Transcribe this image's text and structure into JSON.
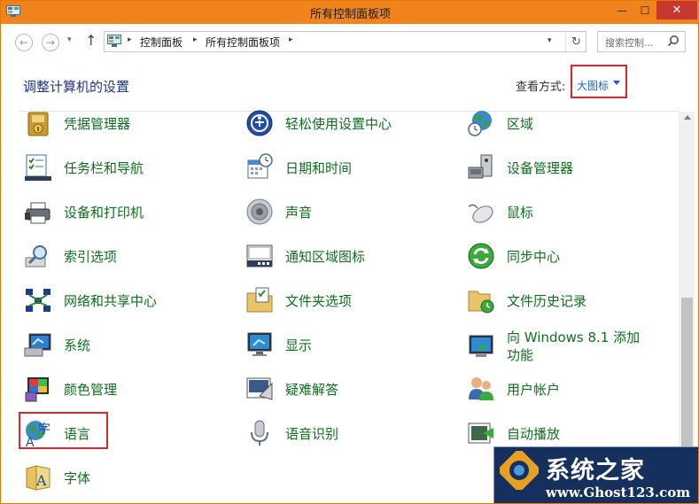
{
  "window": {
    "title": "所有控制面板项",
    "minimize_label": "—",
    "maximize_label": "☐",
    "close_label": "✕",
    "icon": "control-panel-icon"
  },
  "nav": {
    "back_label": "←",
    "forward_label": "→",
    "history_label": "▾",
    "up_label": "↑",
    "breadcrumbs": [
      "控制面板",
      "所有控制面板项"
    ],
    "separator": "▸",
    "dropdown_label": "▾",
    "refresh_label": "↻",
    "search_placeholder": "搜索控制..."
  },
  "header": {
    "title": "调整计算机的设置",
    "view_by_label": "查看方式:",
    "view_by_value": "大图标"
  },
  "items": [
    [
      {
        "label": "凭据管理器",
        "icon": "credential-manager-icon"
      },
      {
        "label": "任务栏和导航",
        "icon": "taskbar-icon"
      },
      {
        "label": "设备和打印机",
        "icon": "printer-icon"
      },
      {
        "label": "索引选项",
        "icon": "indexing-icon"
      },
      {
        "label": "网络和共享中心",
        "icon": "network-icon"
      },
      {
        "label": "系统",
        "icon": "system-icon"
      },
      {
        "label": "颜色管理",
        "icon": "color-management-icon"
      },
      {
        "label": "语言",
        "icon": "language-icon"
      },
      {
        "label": "字体",
        "icon": "fonts-icon"
      }
    ],
    [
      {
        "label": "轻松使用设置中心",
        "icon": "ease-of-access-icon"
      },
      {
        "label": "日期和时间",
        "icon": "calendar-clock-icon"
      },
      {
        "label": "声音",
        "icon": "speaker-icon"
      },
      {
        "label": "通知区域图标",
        "icon": "notification-area-icon"
      },
      {
        "label": "文件夹选项",
        "icon": "folder-options-icon"
      },
      {
        "label": "显示",
        "icon": "display-icon"
      },
      {
        "label": "疑难解答",
        "icon": "troubleshooting-icon"
      },
      {
        "label": "语音识别",
        "icon": "microphone-icon"
      }
    ],
    [
      {
        "label": "区域",
        "icon": "globe-clock-icon"
      },
      {
        "label": "设备管理器",
        "icon": "device-manager-icon"
      },
      {
        "label": "鼠标",
        "icon": "mouse-icon"
      },
      {
        "label": "同步中心",
        "icon": "sync-center-icon"
      },
      {
        "label": "文件历史记录",
        "icon": "file-history-icon"
      },
      {
        "label": "向 Windows 8.1 添加功能",
        "icon": "add-features-icon"
      },
      {
        "label": "用户帐户",
        "icon": "user-accounts-icon"
      },
      {
        "label": "自动播放",
        "icon": "autoplay-icon"
      }
    ]
  ],
  "watermark": {
    "title": "系统之家",
    "url": "www.Ghost123.com"
  },
  "colors": {
    "titlebar": "#f0831b",
    "link_green": "#0f6f1d",
    "heading_blue": "#1e3287",
    "highlight_red": "#e0262b"
  }
}
